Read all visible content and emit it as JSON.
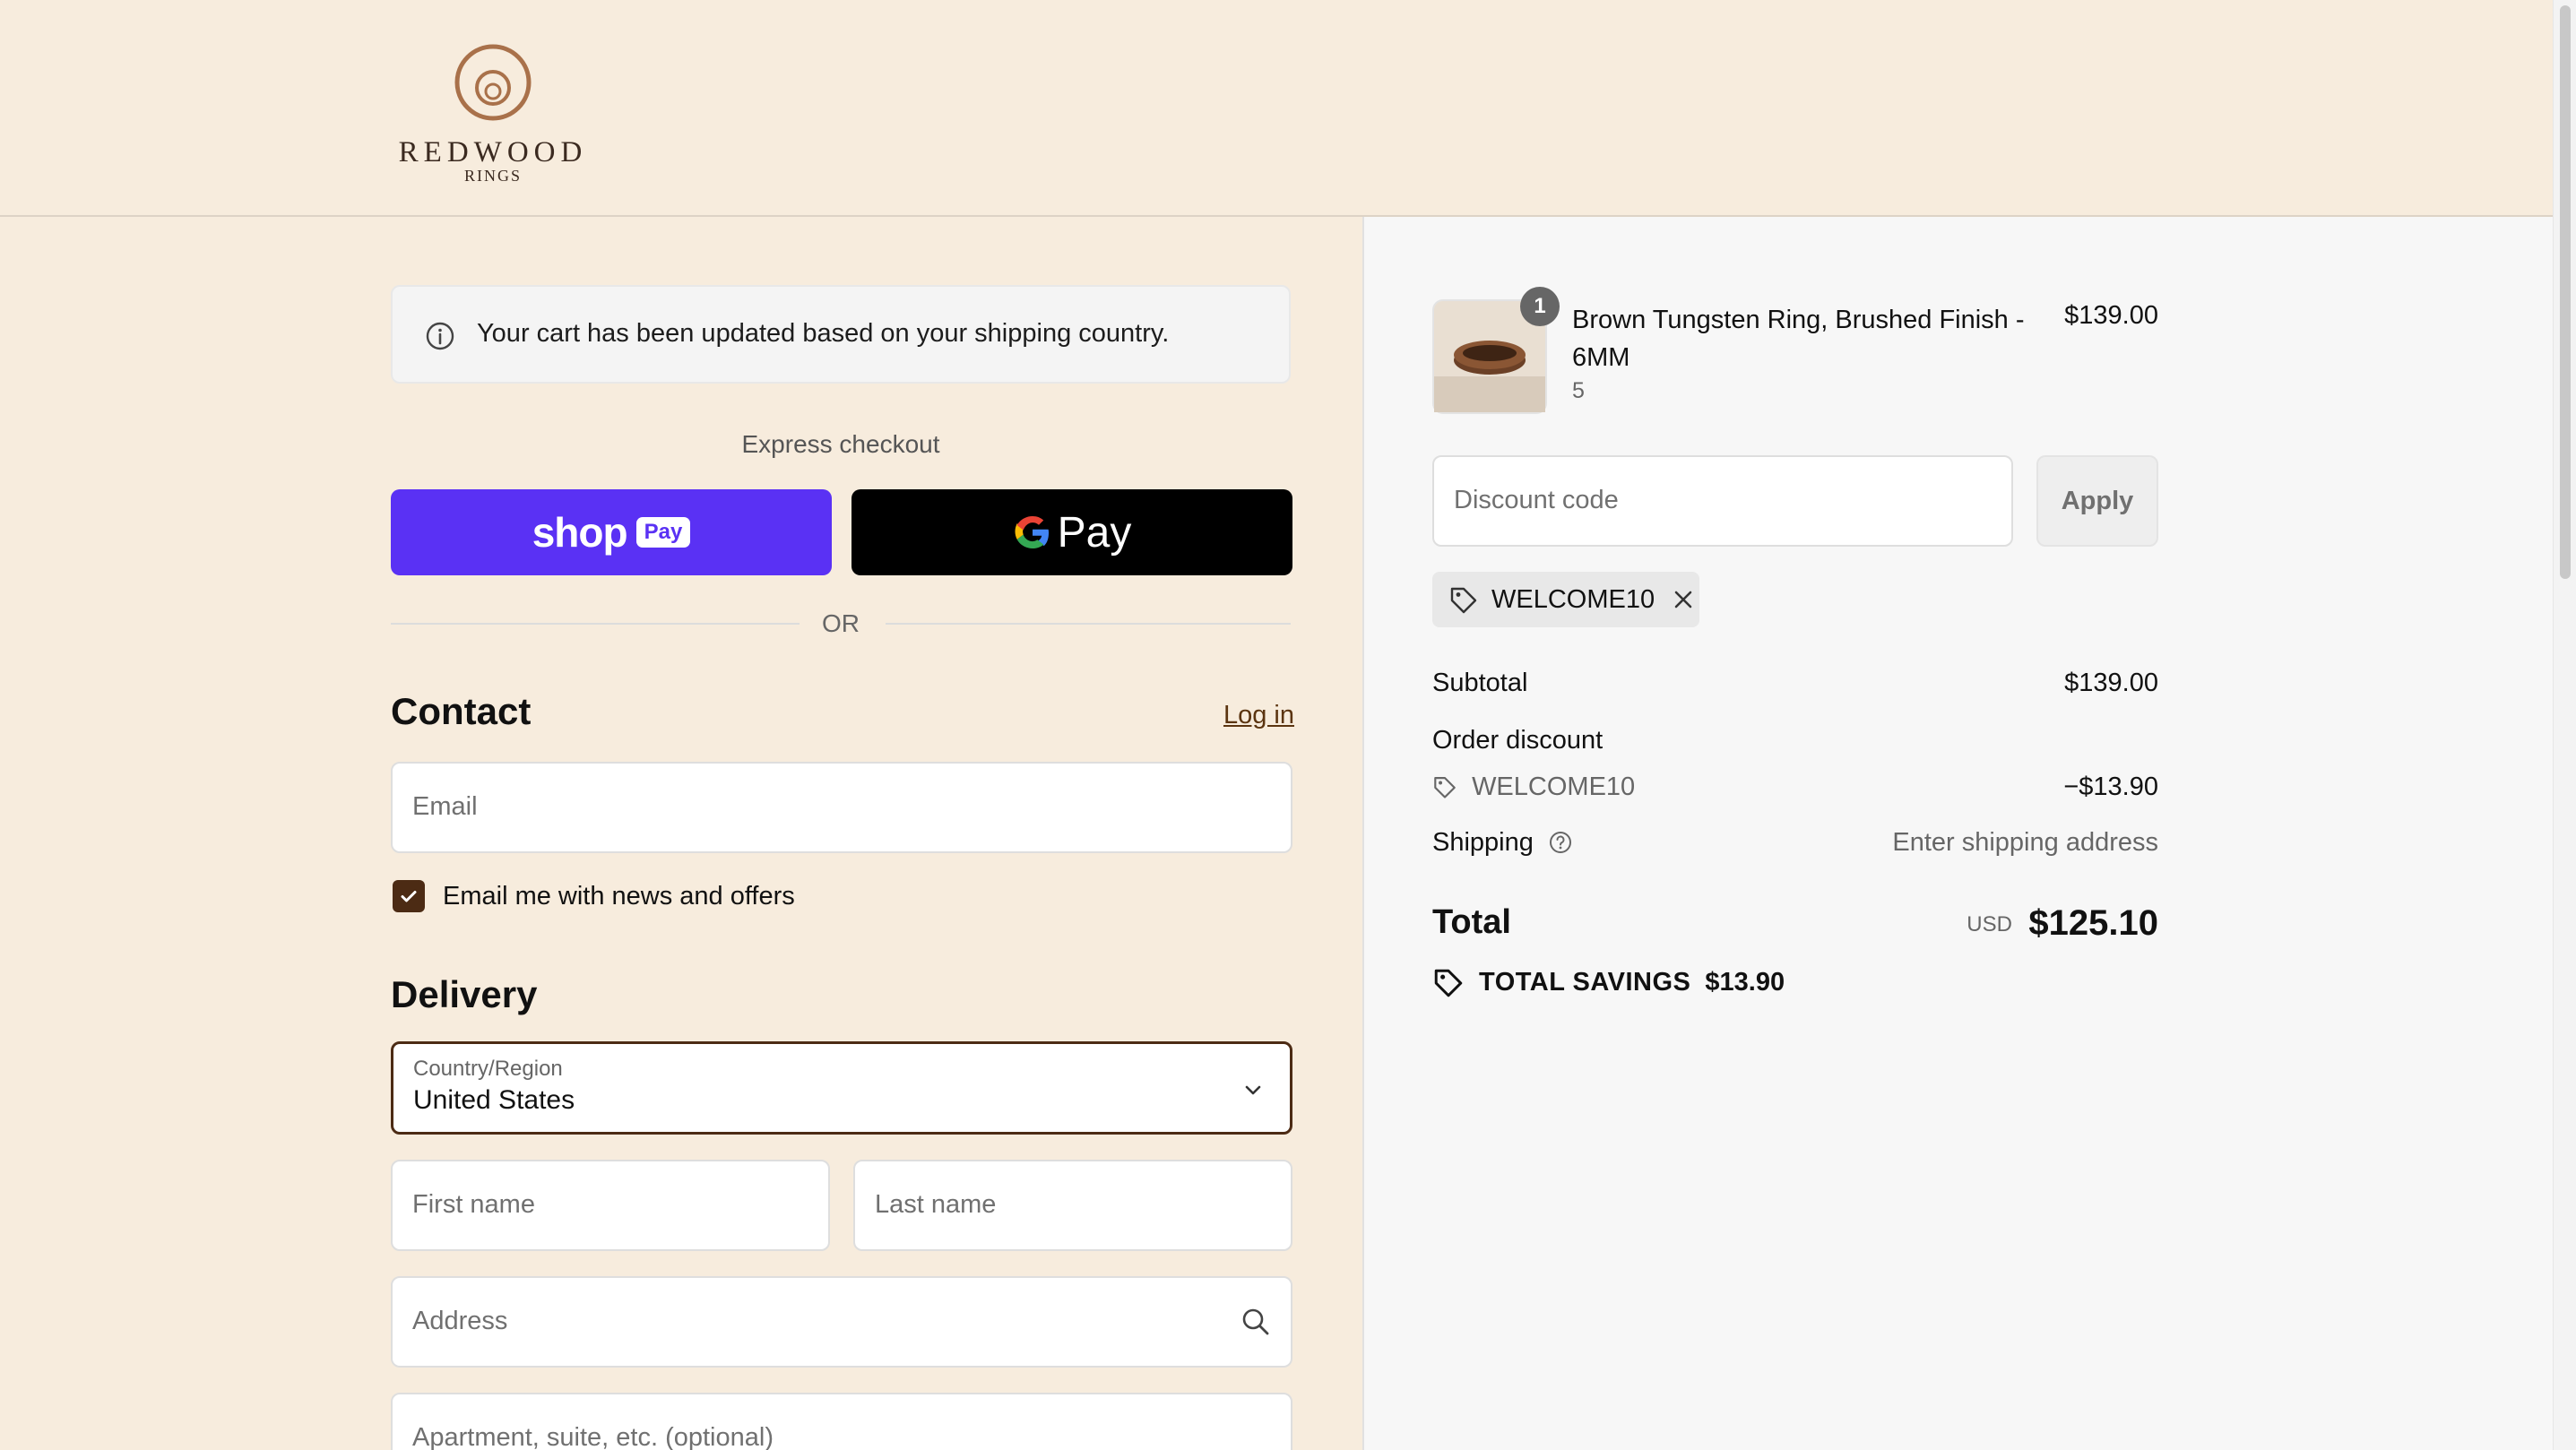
{
  "brand": {
    "name": "REDWOOD",
    "sub": "RINGS"
  },
  "notice": {
    "text": "Your cart has been updated based on your shipping country."
  },
  "express": {
    "label": "Express checkout",
    "shop_pay_word": "shop",
    "shop_pay_badge": "Pay",
    "gpay_word": "Pay",
    "or_text": "OR"
  },
  "contact": {
    "title": "Contact",
    "login_label": "Log in",
    "email_placeholder": "Email",
    "newsletter_label": "Email me with news and offers",
    "newsletter_checked": true
  },
  "delivery": {
    "title": "Delivery",
    "country_label": "Country/Region",
    "country_value": "United States",
    "first_name_placeholder": "First name",
    "last_name_placeholder": "Last name",
    "address_placeholder": "Address",
    "apartment_placeholder": "Apartment, suite, etc. (optional)"
  },
  "order": {
    "product_name": "Brown Tungsten Ring, Brushed Finish - 6MM",
    "product_variant": "5",
    "product_price": "$139.00",
    "quantity": "1",
    "discount_placeholder": "Discount code",
    "apply_label": "Apply",
    "applied_code": "WELCOME10",
    "subtotal_label": "Subtotal",
    "subtotal_value": "$139.00",
    "order_discount_label": "Order discount",
    "discount_code": "WELCOME10",
    "discount_value": "−$13.90",
    "shipping_label": "Shipping",
    "shipping_value": "Enter shipping address",
    "total_label": "Total",
    "total_currency": "USD",
    "total_value": "$125.10",
    "savings_label": "TOTAL SAVINGS",
    "savings_value": "$13.90"
  },
  "colors": {
    "background": "#f7ecdd",
    "accent": "#4c2b14",
    "shop_pay": "#5a31f4",
    "panel": "#f7f7f7"
  }
}
